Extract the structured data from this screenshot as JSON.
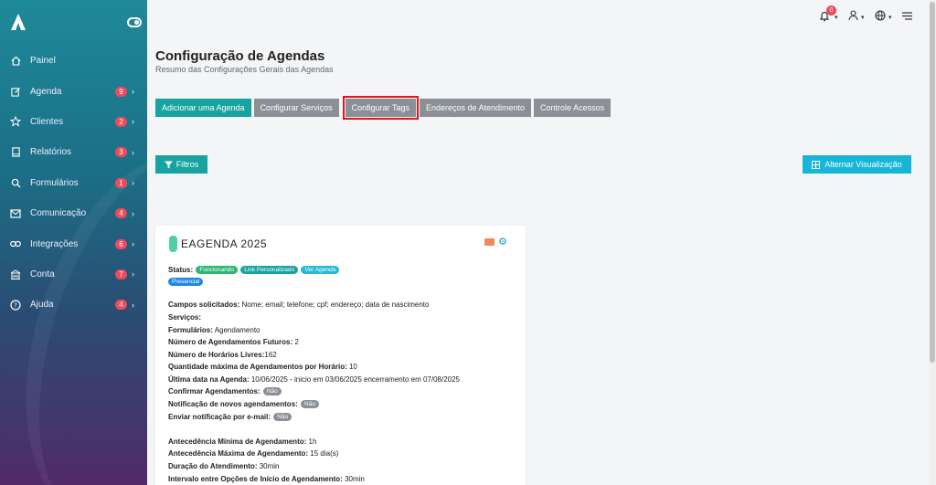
{
  "sidebar": {
    "items": [
      {
        "label": "Painel",
        "icon": "home-icon",
        "badge": null
      },
      {
        "label": "Agenda",
        "icon": "edit-icon",
        "badge": "9"
      },
      {
        "label": "Clientes",
        "icon": "star-icon",
        "badge": "2"
      },
      {
        "label": "Relatórios",
        "icon": "book-icon",
        "badge": "3"
      },
      {
        "label": "Formulários",
        "icon": "search-icon",
        "badge": "1"
      },
      {
        "label": "Comunicação",
        "icon": "mail-icon",
        "badge": "4"
      },
      {
        "label": "Integrações",
        "icon": "link-icon",
        "badge": "6"
      },
      {
        "label": "Conta",
        "icon": "building-icon",
        "badge": "7"
      },
      {
        "label": "Ajuda",
        "icon": "help-icon",
        "badge": "4"
      }
    ]
  },
  "topbar": {
    "notifications": "0"
  },
  "header": {
    "title": "Configuração de Agendas",
    "subtitle": "Resumo das Configurações Gerais das Agendas"
  },
  "actions": {
    "add": "Adicionar uma Agenda",
    "services": "Configurar Serviços",
    "tags": "Configurar Tags",
    "addresses": "Endereços de Atendimento",
    "access": "Controle Acessos"
  },
  "filters": {
    "label": "Filtros",
    "toggle_view": "Alternar Visualização"
  },
  "card": {
    "title": "EAGENDA 2025",
    "status_label": "Status:",
    "tags": {
      "status": "Funcionando",
      "link": "Link Personalizado",
      "view": "Ver Agenda",
      "mode": "Presencial"
    },
    "campos_label": "Campos solicitados:",
    "campos_value": " Nome; email; telefone; cpf; endereço; data de nascimento",
    "servicos_label": "Serviços:",
    "formularios_label": "Formulários:",
    "formularios_value": " Agendamento",
    "futuros_label": "Número de Agendamentos Futuros:",
    "futuros_value": " 2",
    "livres_label": "Número de Horários Livres:",
    "livres_value": "162",
    "qtd_label": "Quantidade máxima de Agendamentos por Horário:",
    "qtd_value": " 10",
    "ultima_label": "Última data na Agenda:",
    "ultima_value": " 10/06/2025 - inicio em 03/06/2025 encerramento em 07/08/2025",
    "confirmar_label": "Confirmar Agendamentos:",
    "notificacao_label": "Notificação de novos agendamentos:",
    "email_label": "Enviar notificação por e-mail:",
    "no": "Não",
    "min_label": "Antecedência Mínima de Agendamento:",
    "min_value": " 1h",
    "max_label": "Antecedência Máxima de Agendamento:",
    "max_value": " 15 dia(s)",
    "duracao_label": "Duração do Atendimento:",
    "duracao_value": " 30min",
    "intervalo_label": "Intervalo entre Opções de Início de Agendamento:",
    "intervalo_value": " 30min"
  },
  "colors": {
    "accent": "#17a3a0",
    "info": "#17b6d6",
    "danger": "#ef4b5c",
    "highlight": "#e0151f"
  }
}
